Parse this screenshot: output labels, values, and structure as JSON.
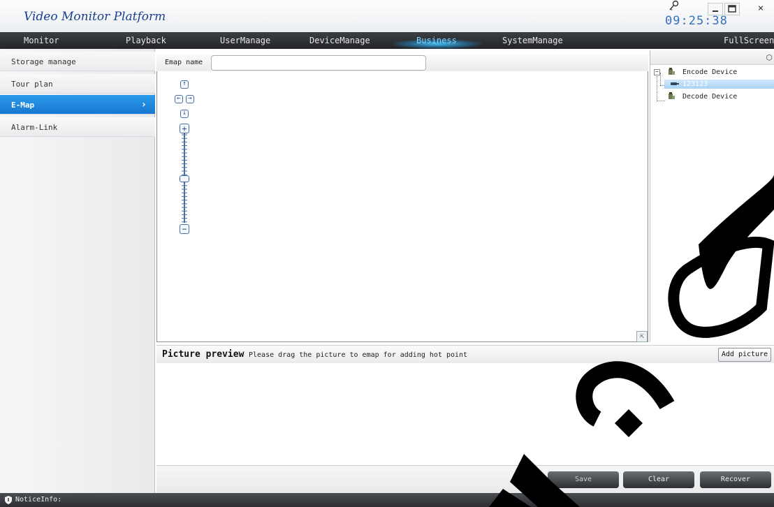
{
  "window": {
    "title": "Video Monitor Platform",
    "clock": "09:25:38",
    "minimize_icon": "minimize-icon",
    "maximize_icon": "maximize-icon",
    "close_label": "×"
  },
  "nav": {
    "items": [
      "Monitor",
      "Playback",
      "UserManage",
      "DeviceManage",
      "Business",
      "SystemManage",
      "FullScreen"
    ],
    "active": "Business",
    "active_color": "#7fd4ff"
  },
  "sidebar": {
    "items": [
      {
        "label": "Storage manage"
      },
      {
        "label": "Tour plan"
      },
      {
        "label": "E-Map",
        "active": true
      },
      {
        "label": "Alarm-Link"
      }
    ],
    "active_color": "#1677d0"
  },
  "emap": {
    "name_label": "Emap name",
    "name_value": ""
  },
  "map_controls": {
    "pan_up": "↑",
    "pan_left": "←",
    "pan_right": "→",
    "pan_down": "↓",
    "zoom_in": "+",
    "zoom_out": "−",
    "zoom_level_fraction": 0.5
  },
  "device_tree": {
    "search_icon": "search-icon",
    "nodes": [
      {
        "label": "Encode Device",
        "expanded": true,
        "children": [
          {
            "label": "123123",
            "selected": true
          }
        ]
      },
      {
        "label": "Decode Device",
        "expanded": false
      }
    ]
  },
  "preview": {
    "title": "Picture preview",
    "hint": "Please drag the picture to emap for adding hot point",
    "add_button": "Add picture"
  },
  "actions": {
    "save": "Save",
    "clear": "Clear",
    "recover": "Recover"
  },
  "status": {
    "notice_label": "NoticeInfo:"
  }
}
